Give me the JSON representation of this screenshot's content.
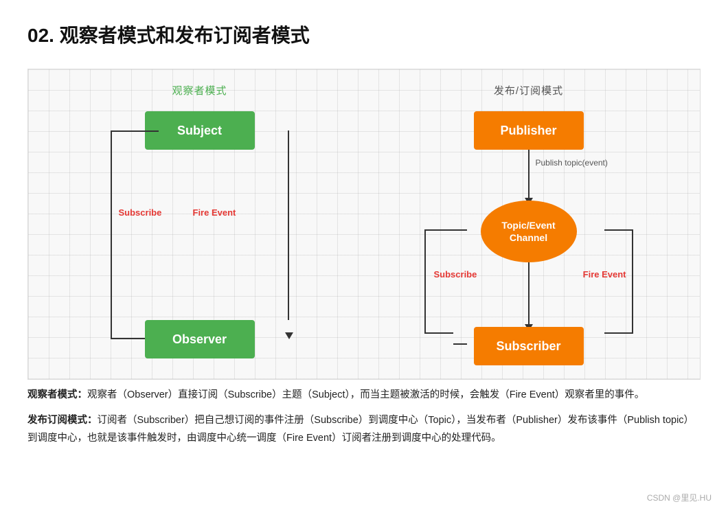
{
  "title": "02. 观察者模式和发布订阅者模式",
  "observer": {
    "label": "观察者模式",
    "subject": "Subject",
    "observer": "Observer",
    "subscribe_label": "Subscribe",
    "fire_event_label": "Fire Event"
  },
  "pubsub": {
    "label": "发布/订阅模式",
    "publisher": "Publisher",
    "channel": "Topic/Event\nChannel",
    "subscriber": "Subscriber",
    "publish_topic": "Publish topic(event)",
    "subscribe_label": "Subscribe",
    "fire_event_label": "Fire Event"
  },
  "desc1_bold": "观察者模式：",
  "desc1_text": "观察者（Observer）直接订阅（Subscribe）主题（Subject），而当主题被激活的时候，会触发（Fire Event）观察者里的事件。",
  "desc2_bold": "发布订阅模式：",
  "desc2_text": "订阅者（Subscriber）把自己想订阅的事件注册（Subscribe）到调度中心（Topic），当发布者（Publisher）发布该事件（Publish topic）到调度中心，也就是该事件触发时，由调度中心统一调度（Fire Event）订阅者注册到调度中心的处理代码。",
  "watermark": "CSDN @里见.HU"
}
